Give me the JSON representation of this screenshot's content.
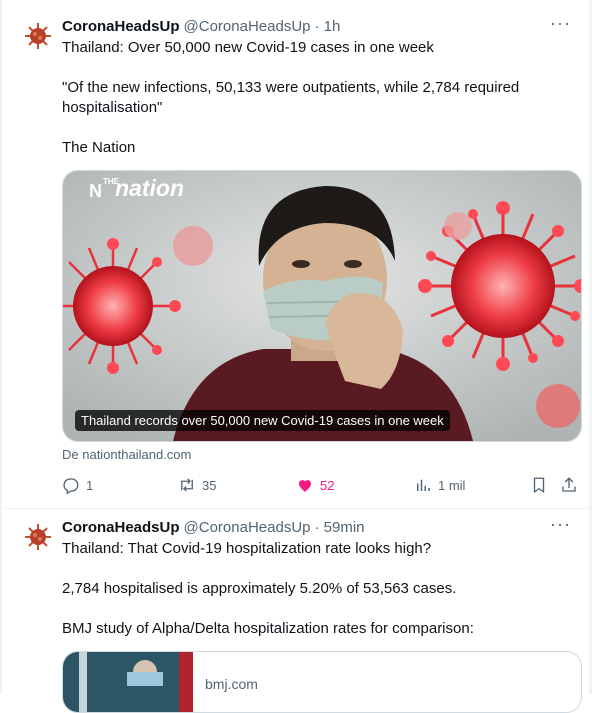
{
  "tweets": [
    {
      "author": "CoronaHeadsUp",
      "handle": "@CoronaHeadsUp",
      "time": "· 1h",
      "lines": [
        "Thailand: Over 50,000 new Covid-19 cases in one week",
        "\"Of the new infections, 50,133 were outpatients, while 2,784 required",
        "hospitalisation\"",
        "The Nation"
      ],
      "card": {
        "logo_small": "THE",
        "logo": "nation",
        "caption": "Thailand records over 50,000 new Covid-19 cases in one week"
      },
      "source": "De nationthailand.com",
      "stats": {
        "replies": "1",
        "retweets": "35",
        "likes": "52",
        "views": "1 mil"
      }
    },
    {
      "author": "CoronaHeadsUp",
      "handle": "@CoronaHeadsUp",
      "time": "· 59min",
      "lines": [
        "Thailand: That Covid-19 hospitalization rate looks high?",
        "2,784 hospitalised is approximately 5.20% of 53,563 cases.",
        "BMJ study of Alpha/Delta hospitalization rates for comparison:"
      ],
      "card": {
        "domain": "bmj.com"
      }
    }
  ],
  "more_glyph": "···",
  "colors": {
    "like": "#f91880",
    "text": "#0f1419",
    "muted": "#536471",
    "virus": "#e8323c"
  }
}
